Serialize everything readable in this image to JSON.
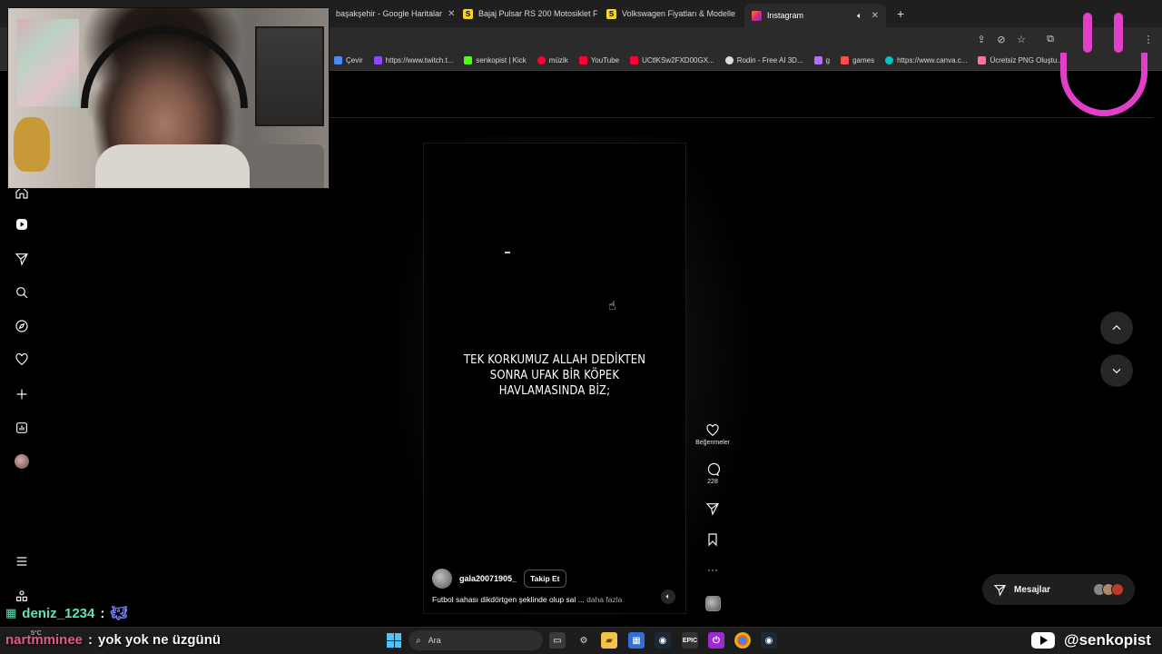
{
  "browser": {
    "tabs": [
      {
        "label": "başakşehir - Google Haritalar",
        "fav": "maps-icon",
        "color": "#34a853",
        "active": false
      },
      {
        "label": "Bajaj Pulsar RS 200 Motosiklet F",
        "fav": "S",
        "color": "#f6d32d",
        "active": false
      },
      {
        "label": "Volkswagen Fiyatları & Modelle",
        "fav": "S",
        "color": "#f6d32d",
        "active": false
      },
      {
        "label": "Instagram",
        "fav": "instagram-icon",
        "color": "#e1306c",
        "active": true
      }
    ],
    "bookmarks": [
      {
        "label": "Çevir",
        "color": "#4c8bf5"
      },
      {
        "label": "https://www.twitch.t...",
        "color": "#9146ff"
      },
      {
        "label": "senkopist | Kick",
        "color": "#53fc18"
      },
      {
        "label": "müzik",
        "color": "#ff0033"
      },
      {
        "label": "YouTube",
        "color": "#ff0033"
      },
      {
        "label": "UCtlKSw2FXD00GX...",
        "color": "#ff0033"
      },
      {
        "label": "Rodin - Free AI 3D...",
        "color": "#dddddd"
      },
      {
        "label": "g",
        "color": "#b86bff"
      },
      {
        "label": "games",
        "color": "#ff4d4d"
      },
      {
        "label": "https://www.canva.c...",
        "color": "#00c4cc"
      },
      {
        "label": "Ücretsiz PNG Oluştu...",
        "color": "#ff6fa8"
      }
    ]
  },
  "reel": {
    "caption_lines": [
      "TEK KORKUMUZ ALLAH DEDİKTEN",
      "SONRA UFAK BİR KÖPEK",
      "HAVLAMASINDA BİZ;"
    ],
    "likes_label": "Beğenmeler",
    "comments_count": "228",
    "username": "gala20071905_",
    "follow_label": "Takip Et",
    "description": "Futbol sahası dikdörtgen şeklinde olup sal ...",
    "more_label": "daha fazla"
  },
  "messages": {
    "label": "Mesajlar"
  },
  "taskbar": {
    "search_placeholder": "Ara"
  },
  "overlay": {
    "chat": [
      {
        "name": "deniz_1234",
        "message": ""
      },
      {
        "name": "nartmminee",
        "message": "yok yok ne üzgünü"
      }
    ],
    "weather": "5°C",
    "channel": "@senkopist"
  }
}
